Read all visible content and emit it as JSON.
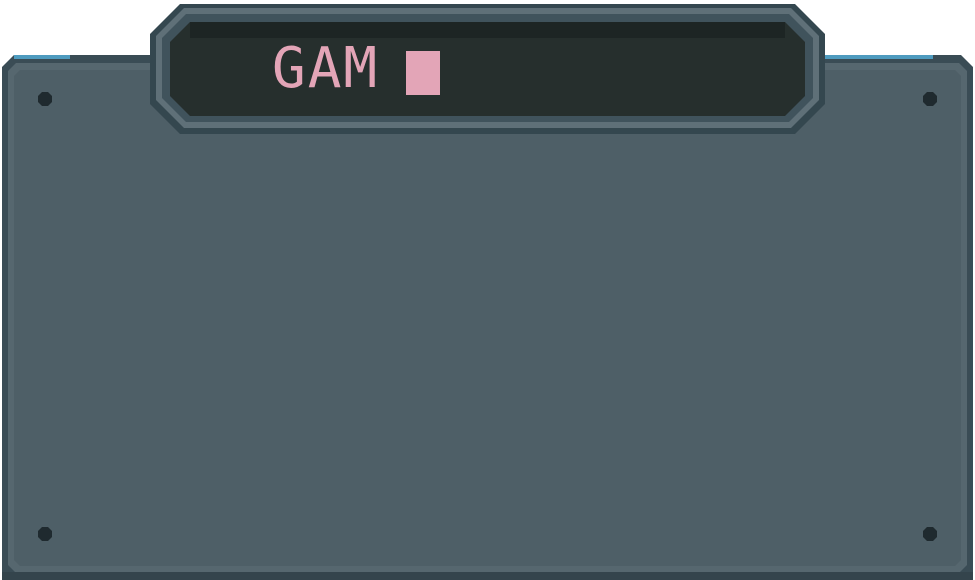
{
  "title_plate": {
    "text": "GAM",
    "cursor": "block-cursor"
  },
  "colors": {
    "panel_frame": "#3a4c55",
    "panel_fill": "#4e5f67",
    "accent_blue": "#4e9bbf",
    "screen_bg": "#262f2d",
    "title_text": "#e3a5b7",
    "rivet": "#1f2a2f"
  },
  "icons": {
    "rivets": [
      "rivet-icon",
      "rivet-icon",
      "rivet-icon",
      "rivet-icon"
    ]
  }
}
